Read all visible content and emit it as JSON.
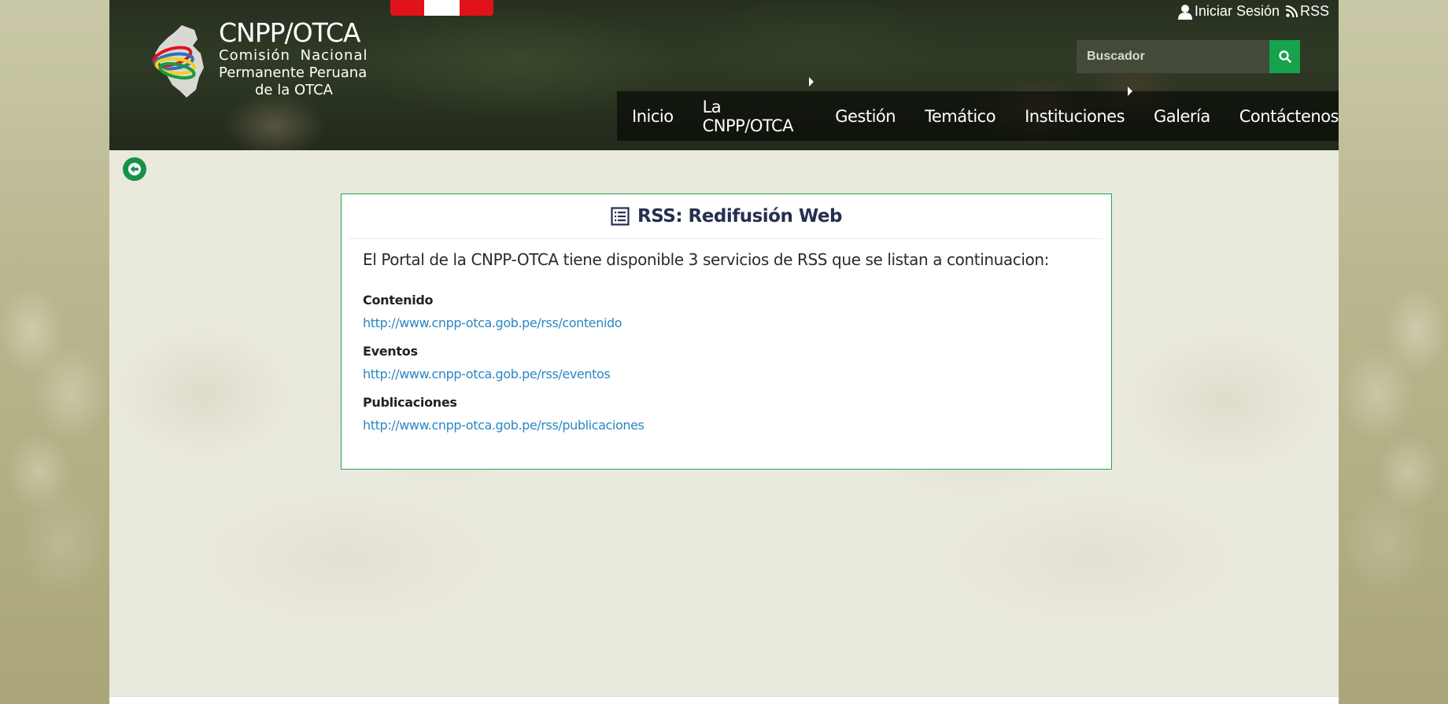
{
  "header": {
    "logo": {
      "title": "CNPP/OTCA",
      "subtitle_line1": "Comisión Nacional",
      "subtitle_line2": "Permanente Peruana",
      "subtitle_line3": "de la OTCA"
    },
    "top_links": {
      "login": "Iniciar Sesión",
      "rss": "RSS"
    },
    "search": {
      "placeholder": "Buscador"
    },
    "nav": [
      {
        "label": "Inicio",
        "has_submenu": false
      },
      {
        "label": "La CNPP/OTCA",
        "has_submenu": true
      },
      {
        "label": "Gestión",
        "has_submenu": false
      },
      {
        "label": "Temático",
        "has_submenu": false
      },
      {
        "label": "Instituciones",
        "has_submenu": true
      },
      {
        "label": "Galería",
        "has_submenu": false
      },
      {
        "label": "Contáctenos",
        "has_submenu": false
      }
    ]
  },
  "card": {
    "icon": "list-alt-icon",
    "title": "RSS: Redifusión Web",
    "intro": "El Portal de la CNPP-OTCA tiene disponible 3 servicios de RSS que se listan a continuacion:",
    "feeds": [
      {
        "label": "Contenido",
        "url": "http://www.cnpp-otca.gob.pe/rss/contenido"
      },
      {
        "label": "Eventos",
        "url": "http://www.cnpp-otca.gob.pe/rss/eventos"
      },
      {
        "label": "Publicaciones",
        "url": "http://www.cnpp-otca.gob.pe/rss/publicaciones"
      }
    ]
  },
  "colors": {
    "accent_green": "#17a24c",
    "link_blue": "#2a87c4",
    "title_navy": "#25304f",
    "flag_red": "#e0131b"
  }
}
